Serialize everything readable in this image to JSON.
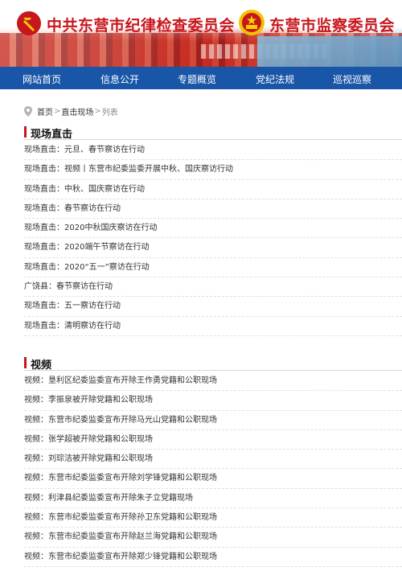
{
  "header": {
    "title_left": "中共东营市纪律检查委员会",
    "title_right": "东营市监察委员会"
  },
  "nav": {
    "items": [
      {
        "label": "网站首页"
      },
      {
        "label": "信息公开"
      },
      {
        "label": "专题概览"
      },
      {
        "label": "党纪法规"
      },
      {
        "label": "巡视巡察"
      }
    ]
  },
  "breadcrumb": {
    "home": "首页",
    "section": "直击现场",
    "current": "列表",
    "separator": ">"
  },
  "sections": [
    {
      "title": "现场直击",
      "items": [
        "现场直击：元旦、春节察访在行动",
        "现场直击：视频丨东营市纪委监委开展中秋、国庆察访行动",
        "现场直击：中秋、国庆察访在行动",
        "现场直击：春节察访在行动",
        "现场直击：2020中秋国庆察访在行动",
        "现场直击：2020端午节察访在行动",
        "现场直击：2020“五一”察访在行动",
        "广饶县：春节察访在行动",
        "现场直击：五一察访在行动",
        "现场直击：清明察访在行动"
      ]
    },
    {
      "title": "视频",
      "items": [
        "视频：垦利区纪委监委宣布开除王作勇党籍和公职现场",
        "视频：李振泉被开除党籍和公职现场",
        "视频：东营市纪委监委宣布开除马光山党籍和公职现场",
        "视频：张学超被开除党籍和公职现场",
        "视频：刘琮洁被开除党籍和公职现场",
        "视频：东营市纪委监委宣布开除刘学锋党籍和公职现场",
        "视频：利津县纪委监委宣布开除朱子立党籍现场",
        "视频：东营市纪委监委宣布开除孙卫东党籍和公职现场",
        "视频：东营市纪委监委宣布开除赵兰海党籍和公职现场",
        "视频：东营市纪委监委宣布开除郑少锋党籍和公职现场"
      ]
    }
  ],
  "colors": {
    "nav_bg": "#1a56a8",
    "title_red": "#c8161d",
    "section_accent": "#c8161d"
  },
  "icons": {
    "party_emblem": "party-emblem-icon",
    "state_emblem": "national-emblem-icon",
    "breadcrumb_pin": "location-pin-icon"
  }
}
